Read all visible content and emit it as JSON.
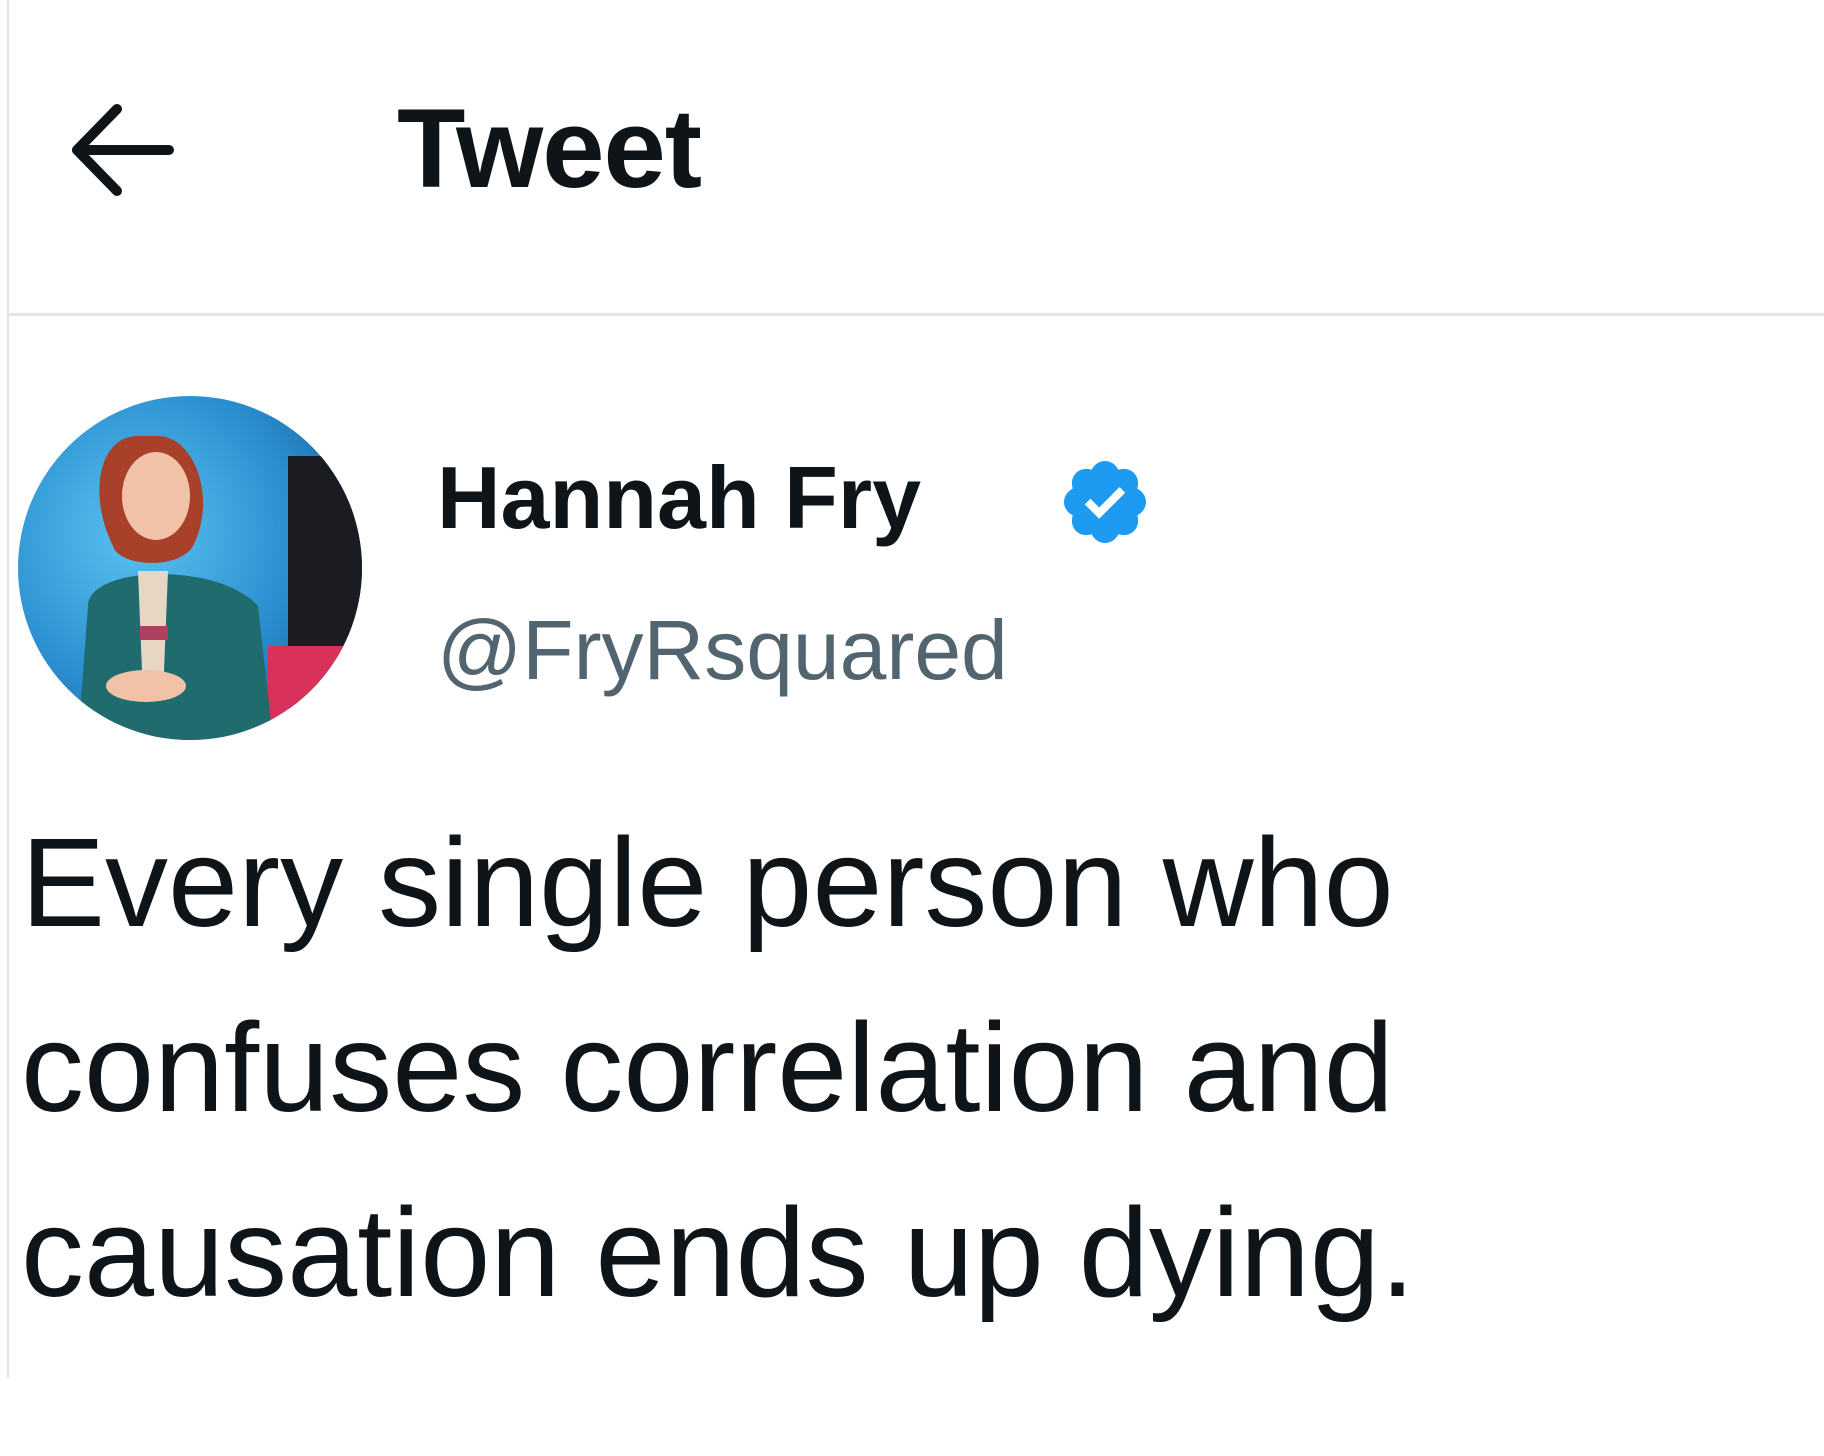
{
  "header": {
    "title": "Tweet",
    "back_icon": "arrow-left-icon"
  },
  "tweet": {
    "author": {
      "name": "Hannah Fry",
      "handle": "@FryRsquared",
      "verified_icon": "verified-badge-icon",
      "verified_color": "#1d9bf0"
    },
    "text_lines": [
      "Every single person who",
      "confuses correlation and",
      "causation ends up dying."
    ]
  },
  "colors": {
    "text_primary": "#0f1419",
    "text_secondary": "#536471",
    "divider": "#e3e6e8"
  }
}
